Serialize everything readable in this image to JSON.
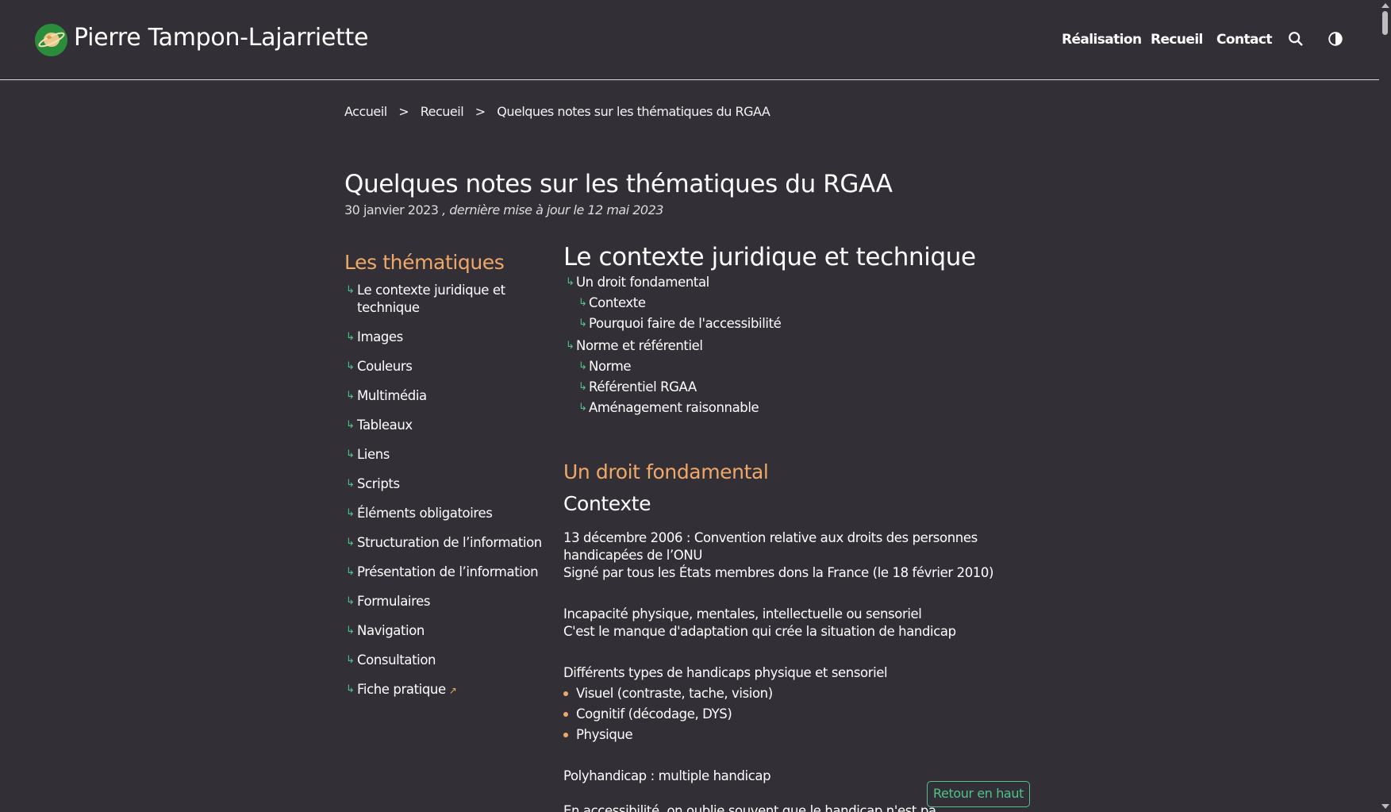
{
  "header": {
    "site_title": "Pierre Tampon-Lajarriette",
    "nav": [
      {
        "label": "Réalisation"
      },
      {
        "label": "Recueil"
      },
      {
        "label": "Contact"
      }
    ],
    "search_icon": "search-icon",
    "theme_icon": "contrast-icon"
  },
  "breadcrumb": {
    "home": "Accueil",
    "parent": "Recueil",
    "current": "Quelques notes sur les thématiques du RGAA",
    "separator": ">"
  },
  "article": {
    "title": "Quelques notes sur les thématiques du RGAA",
    "date": "30 janvier 2023",
    "updated": ", dernière mise à jour le 12 mai 2023"
  },
  "sidebar": {
    "heading": "Les thématiques",
    "items": [
      {
        "label": "Le contexte juridique et technique"
      },
      {
        "label": "Images"
      },
      {
        "label": "Couleurs"
      },
      {
        "label": "Multimédia"
      },
      {
        "label": "Tableaux"
      },
      {
        "label": "Liens"
      },
      {
        "label": "Scripts"
      },
      {
        "label": "Éléments obligatoires"
      },
      {
        "label": "Structuration de l’information"
      },
      {
        "label": "Présentation de l’information"
      },
      {
        "label": "Formulaires"
      },
      {
        "label": "Navigation"
      },
      {
        "label": "Consultation"
      },
      {
        "label": "Fiche pratique"
      }
    ]
  },
  "main": {
    "heading": "Le contexte juridique et technique",
    "toc": {
      "group1": {
        "label": "Un droit fondamental",
        "children": [
          "Contexte",
          "Pourquoi faire de l'accessibilité"
        ]
      },
      "group2": {
        "label": "Norme et référentiel",
        "children": [
          "Norme",
          "Référentiel RGAA",
          "Aménagement raisonnable"
        ]
      }
    },
    "section_title": "Un droit fondamental",
    "subsection_title": "Contexte",
    "paragraphs": {
      "p1_line1": "13 décembre 2006 : Convention relative aux droits des personnes handicapées de l’ONU",
      "p1_line2": "Signé par tous les États membres dons la France (le 18 février 2010)",
      "p2_line1": "Incapacité physique, mentales, intellectuelle ou sensoriel",
      "p2_line2": "C'est le manque d'adaptation qui crée la situation de handicap",
      "p3_intro": "Différents types de handicaps physique et sensoriel",
      "p3_list": [
        "Visuel (contraste, tache, vision)",
        "Cognitif (décodage, DYS)",
        "Physique"
      ],
      "p4": "Polyhandicap : multiple handicap",
      "p5_cut": "En accessibilité, on oublie souvent que le handicap n'est pas toujours définitif"
    },
    "back_to_top": "Retour en haut"
  },
  "colors": {
    "background": "#322f36",
    "accent_orange": "#f0a868",
    "accent_green": "#4fc38a",
    "text": "#ffffff"
  }
}
